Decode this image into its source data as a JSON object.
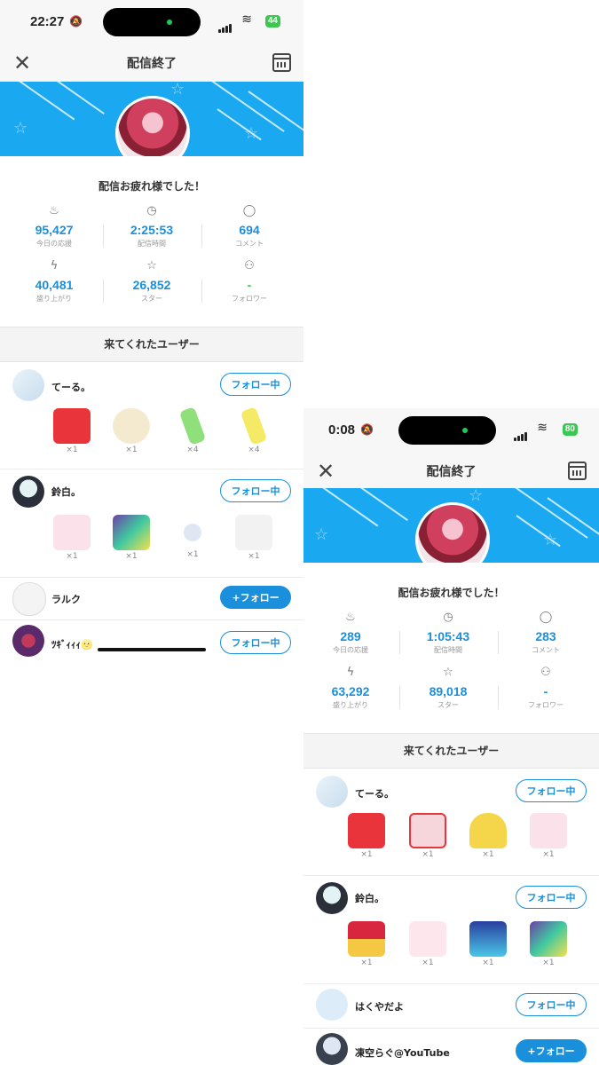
{
  "screen1": {
    "time": "22:27",
    "battery": "44",
    "title": "配信終了",
    "thanks": "配信お疲れ様でした！",
    "stats": [
      {
        "icon": "flame-icon",
        "value": "95,427",
        "label": "今日の応援"
      },
      {
        "icon": "clock-icon",
        "value": "2:25:53",
        "label": "配信時間"
      },
      {
        "icon": "comment-icon",
        "value": "694",
        "label": "コメント"
      },
      {
        "icon": "bolt-icon",
        "value": "40,481",
        "label": "盛り上がり"
      },
      {
        "icon": "star-icon",
        "value": "26,852",
        "label": "スター"
      },
      {
        "icon": "user-icon",
        "value": "-",
        "label": "フォロワー"
      }
    ],
    "section_title": "来てくれたユーザー",
    "users": [
      {
        "name": "てーる。",
        "button": "フォロー中",
        "gifts": [
          {
            "count": "×1",
            "icon": "heart-cat-gift",
            "color": "#e8343a"
          },
          {
            "count": "×1",
            "icon": "plate-gift",
            "color": "#f3ead0"
          },
          {
            "count": "×4",
            "icon": "green-glowstick-gift",
            "color": "#8fe07a"
          },
          {
            "count": "×4",
            "icon": "yellow-glowstick-gift",
            "color": "#f4ea66"
          }
        ]
      },
      {
        "name": "鈴白。",
        "button": "フォロー中",
        "gifts": [
          {
            "count": "×1",
            "icon": "sugoi-gift",
            "color": "#fbe1ea"
          },
          {
            "count": "×1",
            "icon": "spotlight-gift",
            "color": "#6d3fa8"
          },
          {
            "count": "×1",
            "icon": "snowball-gift",
            "color": "#dfe8f2"
          },
          {
            "count": "×1",
            "icon": "zawa-gift",
            "color": "#f2f2f2"
          }
        ]
      },
      {
        "name": "ラルク",
        "button": "+フォロー",
        "primary": true,
        "gifts": []
      },
      {
        "name": "ﾂｷﾞｨｨｨ🌝",
        "button": "フォロー中",
        "gifts": []
      }
    ]
  },
  "screen2": {
    "time": "0:08",
    "battery": "80",
    "title": "配信終了",
    "thanks": "配信お疲れ様でした！",
    "stats": [
      {
        "icon": "flame-icon",
        "value": "289",
        "label": "今日の応援"
      },
      {
        "icon": "clock-icon",
        "value": "1:05:43",
        "label": "配信時間"
      },
      {
        "icon": "comment-icon",
        "value": "283",
        "label": "コメント"
      },
      {
        "icon": "bolt-icon",
        "value": "63,292",
        "label": "盛り上がり"
      },
      {
        "icon": "star-icon",
        "value": "89,018",
        "label": "スター"
      },
      {
        "icon": "user-icon",
        "value": "-",
        "label": "フォロワー"
      }
    ],
    "section_title": "来てくれたユーザー",
    "users": [
      {
        "name": "てーる。",
        "button": "フォロー中",
        "gifts": [
          {
            "count": "×1",
            "icon": "heart-cat-gift",
            "color": "#e8343a"
          },
          {
            "count": "×1",
            "icon": "heart-frame-gift",
            "color": "#f6d6da"
          },
          {
            "count": "×1",
            "icon": "angel-wings-gift",
            "color": "#f5d64a"
          },
          {
            "count": "×1",
            "icon": "sugoi-gift",
            "color": "#fbe1ea"
          }
        ]
      },
      {
        "name": "鈴白。",
        "button": "フォロー中",
        "gifts": [
          {
            "count": "×1",
            "icon": "rose-gift",
            "color": "#d7263d"
          },
          {
            "count": "×1",
            "icon": "kawaii-gift",
            "color": "#fde6ec"
          },
          {
            "count": "×1",
            "icon": "stage-gift",
            "color": "#2a3f9e"
          },
          {
            "count": "×1",
            "icon": "spotlight-gift",
            "color": "#6d3fa8"
          }
        ]
      },
      {
        "name": "はくやだよ",
        "button": "フォロー中",
        "gifts": []
      },
      {
        "name": "凍空らぐ@YouTube",
        "button": "+フォロー",
        "primary": true,
        "gifts": []
      }
    ]
  }
}
